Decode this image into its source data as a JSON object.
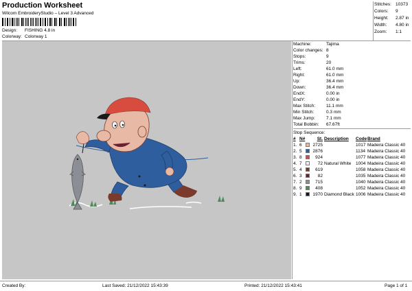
{
  "header": {
    "title": "Production Worksheet",
    "subtitle": "Wilcom EmbroideryStudio – Level 3 Advanced",
    "design_label": "Design:",
    "design_value": "FISHING 4.8 in",
    "colorway_label": "Colorway:",
    "colorway_value": "Colorway 1"
  },
  "stats": [
    {
      "label": "Stitches:",
      "value": "10373"
    },
    {
      "label": "Colors:",
      "value": "9"
    },
    {
      "label": "Height:",
      "value": "2.87 in"
    },
    {
      "label": "Width:",
      "value": "4.80 in"
    },
    {
      "label": "Zoom:",
      "value": "1:1"
    }
  ],
  "details": [
    {
      "label": "Machine:",
      "value": "Tajima"
    },
    {
      "label": "Color changes:",
      "value": "8"
    },
    {
      "label": "Stops:",
      "value": "9"
    },
    {
      "label": "Trims:",
      "value": "20"
    },
    {
      "label": "Left:",
      "value": "61.0 mm"
    },
    {
      "label": "Right:",
      "value": "61.0 mm"
    },
    {
      "label": "Up:",
      "value": "36.4 mm"
    },
    {
      "label": "Down:",
      "value": "36.4 mm"
    },
    {
      "label": "EndX:",
      "value": "0.00 in"
    },
    {
      "label": "EndY:",
      "value": "0.00 in"
    },
    {
      "label": "Max Stitch:",
      "value": "11.1 mm"
    },
    {
      "label": "Min Stitch:",
      "value": "0.3 mm"
    },
    {
      "label": "Max Jump:",
      "value": "7.1 mm"
    },
    {
      "label": "Total Bobbin:",
      "value": "67.67ft"
    }
  ],
  "sequence": {
    "label": "Stop Sequence:",
    "headers": {
      "num": "#",
      "n": "N#",
      "st": "St.",
      "desc": "Description",
      "code": "Code",
      "brand": "Brand"
    },
    "rows": [
      {
        "num": "1.",
        "n": "6",
        "color": "#e8b9a4",
        "st": "2725",
        "desc": "",
        "code": "1017",
        "brand": "Madeira Classic 40"
      },
      {
        "num": "2.",
        "n": "5",
        "color": "#2e5e9e",
        "st": "2876",
        "desc": "",
        "code": "1134",
        "brand": "Madeira Classic 40"
      },
      {
        "num": "3.",
        "n": "8",
        "color": "#d84b3f",
        "st": "924",
        "desc": "",
        "code": "1077",
        "brand": "Madeira Classic 40"
      },
      {
        "num": "4.",
        "n": "7",
        "color": "#f4f4f4",
        "st": "72",
        "desc": "Natural White",
        "code": "1004",
        "brand": "Madeira Classic 40"
      },
      {
        "num": "5.",
        "n": "4",
        "color": "#7a3a2c",
        "st": "619",
        "desc": "",
        "code": "1058",
        "brand": "Madeira Classic 40"
      },
      {
        "num": "6.",
        "n": "3",
        "color": "#6e1f33",
        "st": "82",
        "desc": "",
        "code": "1035",
        "brand": "Madeira Classic 40"
      },
      {
        "num": "7.",
        "n": "2",
        "color": "#8b8f95",
        "st": "715",
        "desc": "",
        "code": "1040",
        "brand": "Madeira Classic 40"
      },
      {
        "num": "8.",
        "n": "9",
        "color": "#4e8a5c",
        "st": "408",
        "desc": "",
        "code": "1052",
        "brand": "Madeira Classic 40"
      },
      {
        "num": "9.",
        "n": "1",
        "color": "#1a1a1a",
        "st": "1970",
        "desc": "Diamond Black",
        "code": "1006",
        "brand": "Madeira Classic 40"
      }
    ]
  },
  "footer": {
    "created_by": "Created By:",
    "last_saved": "Last Saved: 21/12/2022 15:43:39",
    "printed": "Printed: 21/12/2022 15:43:41",
    "page": "Page 1 of 1"
  },
  "colors": {
    "canvas": "#c6c6c6",
    "rule": "#9a9a9a"
  }
}
